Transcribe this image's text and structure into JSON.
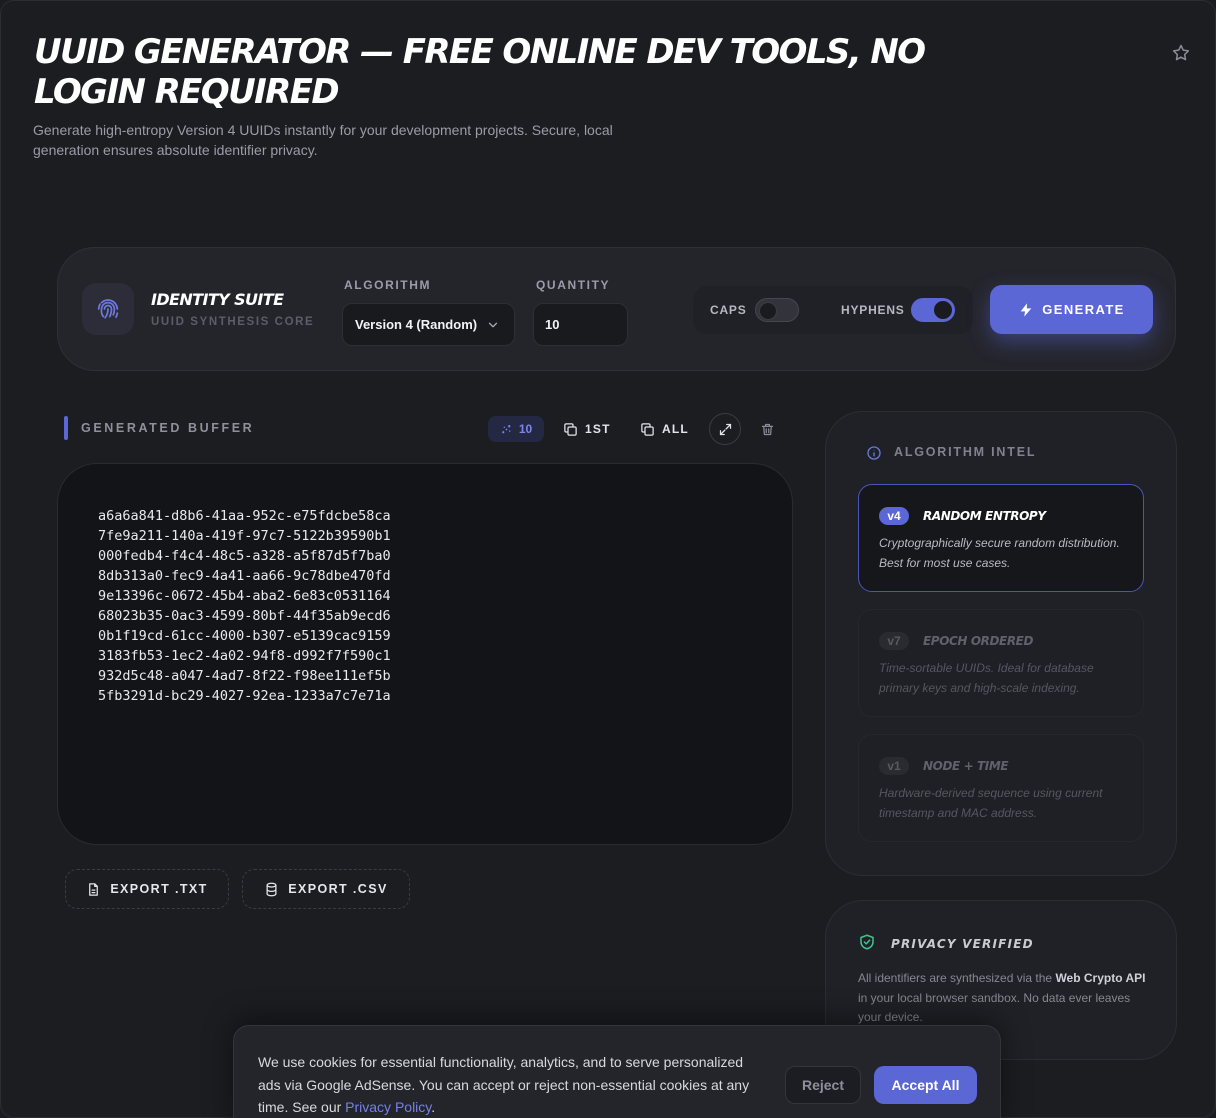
{
  "header": {
    "title": "UUID GENERATOR — FREE ONLINE DEV TOOLS, NO LOGIN REQUIRED",
    "subtitle": "Generate high-entropy Version 4 UUIDs instantly for your development projects. Secure, local generation ensures absolute identifier privacy.",
    "star_icon": "star-icon"
  },
  "suite": {
    "name": "IDENTITY SUITE",
    "sub": "UUID SYNTHESIS CORE",
    "icon": "fingerprint-icon"
  },
  "controls": {
    "algorithm_label": "ALGORITHM",
    "algorithm_value": "Version 4 (Random)",
    "quantity_label": "QUANTITY",
    "quantity_value": "10",
    "caps_label": "CAPS",
    "caps_on": false,
    "hyphens_label": "HYPHENS",
    "hyphens_on": true,
    "generate_label": "GENERATE"
  },
  "buffer": {
    "title": "GENERATED BUFFER",
    "count": "10",
    "copy_first_label": "1ST",
    "copy_all_label": "ALL",
    "uuids": [
      "a6a6a841-d8b6-41aa-952c-e75fdcbe58ca",
      "7fe9a211-140a-419f-97c7-5122b39590b1",
      "000fedb4-f4c4-48c5-a328-a5f87d5f7ba0",
      "8db313a0-fec9-4a41-aa66-9c78dbe470fd",
      "9e13396c-0672-45b4-aba2-6e83c0531164",
      "68023b35-0ac3-4599-80bf-44f35ab9ecd6",
      "0b1f19cd-61cc-4000-b307-e5139cac9159",
      "3183fb53-1ec2-4a02-94f8-d992f7f590c1",
      "932d5c48-a047-4ad7-8f22-f98ee111ef5b",
      "5fb3291d-bc29-4027-92ea-1233a7c7e71a"
    ],
    "export_txt": "EXPORT .TXT",
    "export_csv": "EXPORT .CSV"
  },
  "intel": {
    "title": "ALGORITHM INTEL",
    "cards": [
      {
        "badge": "v4",
        "name": "RANDOM ENTROPY",
        "desc": "Cryptographically secure random distribution. Best for most use cases.",
        "active": true
      },
      {
        "badge": "v7",
        "name": "EPOCH ORDERED",
        "desc": "Time-sortable UUIDs. Ideal for database primary keys and high-scale indexing.",
        "active": false
      },
      {
        "badge": "v1",
        "name": "NODE + TIME",
        "desc": "Hardware-derived sequence using current timestamp and MAC address.",
        "active": false
      }
    ]
  },
  "privacy": {
    "title": "PRIVACY VERIFIED",
    "text_before": "All identifiers are synthesized via the ",
    "text_bold": "Web Crypto API",
    "text_after": " in your local browser sandbox. No data ever leaves your device."
  },
  "cookie": {
    "text": "We use cookies for essential functionality, analytics, and to serve personalized ads via Google AdSense. You can accept or reject non-essential cookies at any time. See our ",
    "link": "Privacy Policy",
    "end": ".",
    "reject": "Reject",
    "accept": "Accept All"
  },
  "colors": {
    "accent": "#5b67d4",
    "background": "#1c1d21",
    "panel": "#24252b",
    "output_bg": "#131417",
    "success": "#3ec48f"
  }
}
